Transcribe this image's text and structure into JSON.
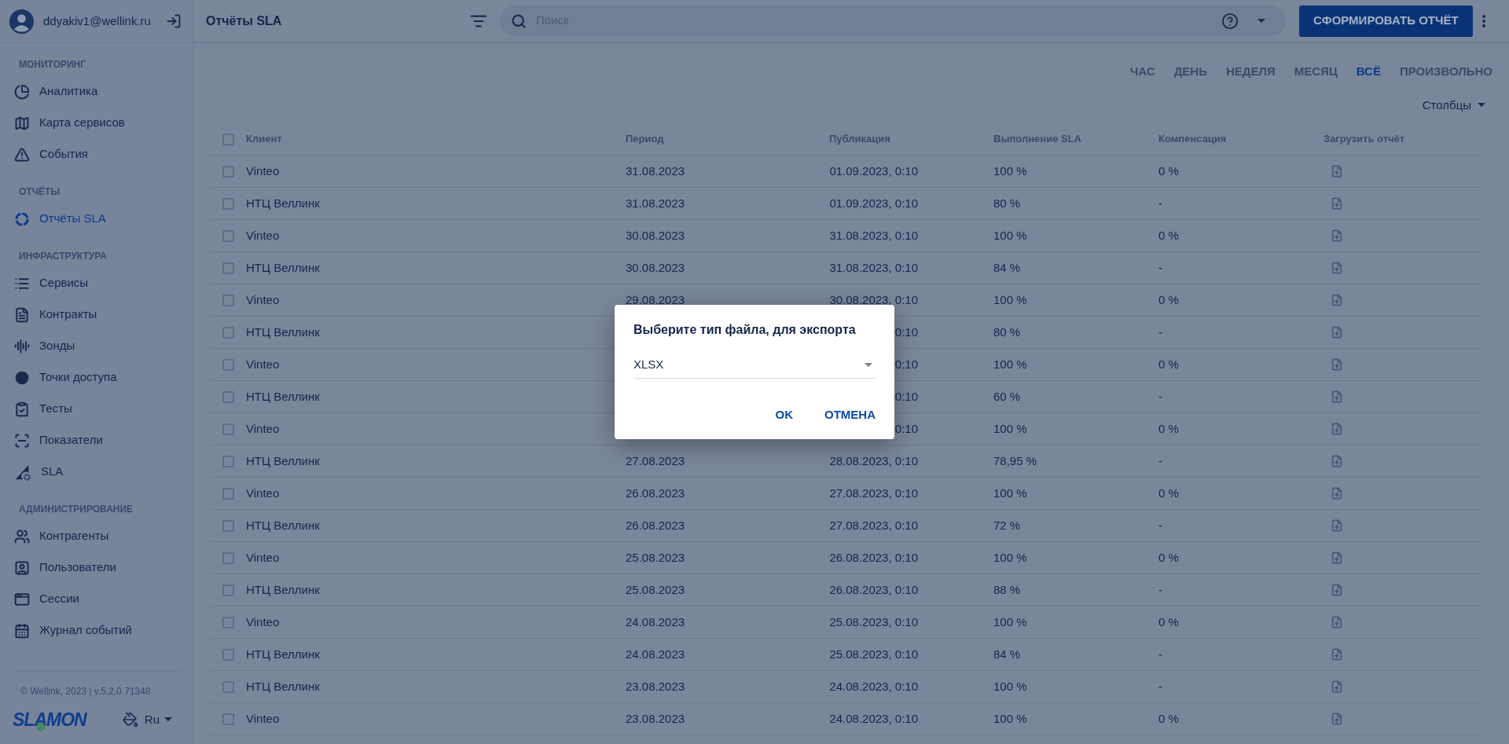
{
  "user": {
    "email": "ddyakiv1@wellink.ru"
  },
  "sidebar": {
    "sections": [
      {
        "title": "МОНИТОРИНГ",
        "items": [
          {
            "label": "Аналитика",
            "selected": false
          },
          {
            "label": "Карта сервисов",
            "selected": false
          },
          {
            "label": "События",
            "selected": false
          }
        ]
      },
      {
        "title": "ОТЧЁТЫ",
        "items": [
          {
            "label": "Отчёты SLA",
            "selected": true
          }
        ]
      },
      {
        "title": "ИНФРАСТРУКТУРА",
        "items": [
          {
            "label": "Сервисы",
            "selected": false
          },
          {
            "label": "Контракты",
            "selected": false
          },
          {
            "label": "Зонды",
            "selected": false
          },
          {
            "label": "Точки доступа",
            "selected": false
          },
          {
            "label": "Тесты",
            "selected": false
          },
          {
            "label": "Показатели",
            "selected": false
          },
          {
            "label": "SLA",
            "selected": false
          }
        ]
      },
      {
        "title": "АДМИНИСТРИРОВАНИЕ",
        "items": [
          {
            "label": "Контрагенты",
            "selected": false
          },
          {
            "label": "Пользователи",
            "selected": false
          },
          {
            "label": "Сессии",
            "selected": false
          },
          {
            "label": "Журнал событий",
            "selected": false
          }
        ]
      }
    ]
  },
  "footer": {
    "copyright": "© Wellink, 2023 | v.5.2.0.71348",
    "logo": "SLAMON",
    "language": "Ru"
  },
  "header": {
    "title": "Отчёты SLA",
    "search_placeholder": "Поиск",
    "action_button": "СФОРМИРОВАТЬ ОТЧЁТ"
  },
  "period_tabs": [
    {
      "label": "ЧАС",
      "selected": false
    },
    {
      "label": "ДЕНЬ",
      "selected": false
    },
    {
      "label": "НЕДЕЛЯ",
      "selected": false
    },
    {
      "label": "МЕСЯЦ",
      "selected": false
    },
    {
      "label": "ВСЁ",
      "selected": true
    },
    {
      "label": "ПРОИЗВОЛЬНО",
      "selected": false
    }
  ],
  "columns_button": "Столбцы",
  "table": {
    "select_all_checked": false,
    "columns": [
      "Клиент",
      "Период",
      "Публикация",
      "Выполнение SLA",
      "Компенсация",
      "Загрузить отчёт"
    ],
    "rows": [
      {
        "checked": false,
        "client": "Vinteo",
        "period": "31.08.2023",
        "published": "01.09.2023, 0:10",
        "sla": "100 %",
        "compensation": "0 %"
      },
      {
        "checked": false,
        "client": "НТЦ Веллинк",
        "period": "31.08.2023",
        "published": "01.09.2023, 0:10",
        "sla": "80 %",
        "compensation": "-"
      },
      {
        "checked": false,
        "client": "Vinteo",
        "period": "30.08.2023",
        "published": "31.08.2023, 0:10",
        "sla": "100 %",
        "compensation": "0 %"
      },
      {
        "checked": false,
        "client": "НТЦ Веллинк",
        "period": "30.08.2023",
        "published": "31.08.2023, 0:10",
        "sla": "84 %",
        "compensation": "-"
      },
      {
        "checked": false,
        "client": "Vinteo",
        "period": "29.08.2023",
        "published": "30.08.2023, 0:10",
        "sla": "100 %",
        "compensation": "0 %"
      },
      {
        "checked": false,
        "client": "НТЦ Веллинк",
        "published": "0:10",
        "sla": "80 %",
        "compensation": "-"
      },
      {
        "checked": false,
        "client": "Vinteo",
        "published": "0:10",
        "sla": "100 %",
        "compensation": "0 %"
      },
      {
        "checked": false,
        "client": "НТЦ Веллинк",
        "published": "0:10",
        "sla": "60 %",
        "compensation": "-"
      },
      {
        "checked": false,
        "client": "Vinteo",
        "published": "0:10",
        "sla": "100 %",
        "compensation": "0 %"
      },
      {
        "checked": false,
        "client": "НТЦ Веллинк",
        "period": "27.08.2023",
        "published": "28.08.2023, 0:10",
        "sla": "78,95 %",
        "compensation": "-"
      },
      {
        "checked": false,
        "client": "Vinteo",
        "period": "26.08.2023",
        "published": "27.08.2023, 0:10",
        "sla": "100 %",
        "compensation": "0 %"
      },
      {
        "checked": false,
        "client": "НТЦ Веллинк",
        "period": "26.08.2023",
        "published": "27.08.2023, 0:10",
        "sla": "72 %",
        "compensation": "-"
      },
      {
        "checked": false,
        "client": "Vinteo",
        "period": "25.08.2023",
        "published": "26.08.2023, 0:10",
        "sla": "100 %",
        "compensation": "0 %"
      },
      {
        "checked": false,
        "client": "НТЦ Веллинк",
        "period": "25.08.2023",
        "published": "26.08.2023, 0:10",
        "sla": "88 %",
        "compensation": "-"
      },
      {
        "checked": false,
        "client": "Vinteo",
        "period": "24.08.2023",
        "published": "25.08.2023, 0:10",
        "sla": "100 %",
        "compensation": "0 %"
      },
      {
        "checked": false,
        "client": "НТЦ Веллинк",
        "period": "24.08.2023",
        "published": "25.08.2023, 0:10",
        "sla": "84 %",
        "compensation": "-"
      },
      {
        "checked": false,
        "client": "НТЦ Веллинк",
        "period": "23.08.2023",
        "published": "24.08.2023, 0:10",
        "sla": "100 %",
        "compensation": "-"
      },
      {
        "checked": false,
        "client": "Vinteo",
        "period": "23.08.2023",
        "published": "24.08.2023, 0:10",
        "sla": "100 %",
        "compensation": "0 %"
      }
    ]
  },
  "dialog": {
    "title": "Выберите тип файла, для экспорта",
    "file_type": "XLSX",
    "buttons": [
      "OK",
      "ОТМЕНА"
    ]
  }
}
